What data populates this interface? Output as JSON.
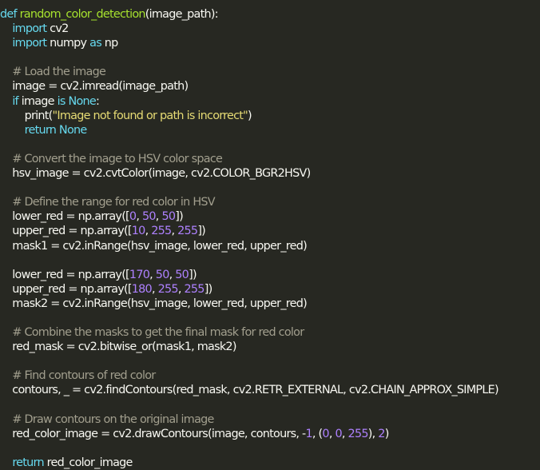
{
  "theme": {
    "background": "#272822",
    "foreground": "#f8f8f2",
    "keyword": "#66d9ef",
    "function": "#a6e22e",
    "comment": "#a29f8e",
    "string": "#e6db74",
    "number": "#ae81ff"
  },
  "code": {
    "lines": [
      [
        {
          "t": "kw",
          "v": "def "
        },
        {
          "t": "fn",
          "v": "random_color_detection"
        },
        {
          "t": "pl",
          "v": "(image_path):"
        }
      ],
      [
        {
          "t": "pl",
          "v": "    "
        },
        {
          "t": "kw",
          "v": "import"
        },
        {
          "t": "pl",
          "v": " cv2"
        }
      ],
      [
        {
          "t": "pl",
          "v": "    "
        },
        {
          "t": "kw",
          "v": "import"
        },
        {
          "t": "pl",
          "v": " numpy "
        },
        {
          "t": "kw",
          "v": "as"
        },
        {
          "t": "pl",
          "v": " np"
        }
      ],
      [],
      [
        {
          "t": "pl",
          "v": "    "
        },
        {
          "t": "cm",
          "v": "# Load the image"
        }
      ],
      [
        {
          "t": "pl",
          "v": "    image = cv2.imread(image_path)"
        }
      ],
      [
        {
          "t": "pl",
          "v": "    "
        },
        {
          "t": "kw",
          "v": "if"
        },
        {
          "t": "pl",
          "v": " image "
        },
        {
          "t": "kw",
          "v": "is None"
        },
        {
          "t": "pl",
          "v": ":"
        }
      ],
      [
        {
          "t": "pl",
          "v": "        print("
        },
        {
          "t": "st",
          "v": "\"Image not found or path is incorrect\""
        },
        {
          "t": "pl",
          "v": ")"
        }
      ],
      [
        {
          "t": "pl",
          "v": "        "
        },
        {
          "t": "kw",
          "v": "return None"
        }
      ],
      [],
      [
        {
          "t": "pl",
          "v": "    "
        },
        {
          "t": "cm",
          "v": "# Convert the image to HSV color space"
        }
      ],
      [
        {
          "t": "pl",
          "v": "    hsv_image = cv2.cvtColor(image, cv2.COLOR_BGR2HSV)"
        }
      ],
      [],
      [
        {
          "t": "pl",
          "v": "    "
        },
        {
          "t": "cm",
          "v": "# Define the range for red color in HSV"
        }
      ],
      [
        {
          "t": "pl",
          "v": "    lower_red = np.array(["
        },
        {
          "t": "nm",
          "v": "0"
        },
        {
          "t": "pl",
          "v": ", "
        },
        {
          "t": "nm",
          "v": "50"
        },
        {
          "t": "pl",
          "v": ", "
        },
        {
          "t": "nm",
          "v": "50"
        },
        {
          "t": "pl",
          "v": "])"
        }
      ],
      [
        {
          "t": "pl",
          "v": "    upper_red = np.array(["
        },
        {
          "t": "nm",
          "v": "10"
        },
        {
          "t": "pl",
          "v": ", "
        },
        {
          "t": "nm",
          "v": "255"
        },
        {
          "t": "pl",
          "v": ", "
        },
        {
          "t": "nm",
          "v": "255"
        },
        {
          "t": "pl",
          "v": "])"
        }
      ],
      [
        {
          "t": "pl",
          "v": "    mask1 = cv2.inRange(hsv_image, lower_red, upper_red)"
        }
      ],
      [],
      [
        {
          "t": "pl",
          "v": "    lower_red = np.array(["
        },
        {
          "t": "nm",
          "v": "170"
        },
        {
          "t": "pl",
          "v": ", "
        },
        {
          "t": "nm",
          "v": "50"
        },
        {
          "t": "pl",
          "v": ", "
        },
        {
          "t": "nm",
          "v": "50"
        },
        {
          "t": "pl",
          "v": "])"
        }
      ],
      [
        {
          "t": "pl",
          "v": "    upper_red = np.array(["
        },
        {
          "t": "nm",
          "v": "180"
        },
        {
          "t": "pl",
          "v": ", "
        },
        {
          "t": "nm",
          "v": "255"
        },
        {
          "t": "pl",
          "v": ", "
        },
        {
          "t": "nm",
          "v": "255"
        },
        {
          "t": "pl",
          "v": "])"
        }
      ],
      [
        {
          "t": "pl",
          "v": "    mask2 = cv2.inRange(hsv_image, lower_red, upper_red)"
        }
      ],
      [],
      [
        {
          "t": "pl",
          "v": "    "
        },
        {
          "t": "cm",
          "v": "# Combine the masks to get the final mask for red color"
        }
      ],
      [
        {
          "t": "pl",
          "v": "    red_mask = cv2.bitwise_or(mask1, mask2)"
        }
      ],
      [],
      [
        {
          "t": "pl",
          "v": "    "
        },
        {
          "t": "cm",
          "v": "# Find contours of red color"
        }
      ],
      [
        {
          "t": "pl",
          "v": "    contours, _ = cv2.findContours(red_mask, cv2.RETR_EXTERNAL, cv2.CHAIN_APPROX_SIMPLE)"
        }
      ],
      [],
      [
        {
          "t": "pl",
          "v": "    "
        },
        {
          "t": "cm",
          "v": "# Draw contours on the original image"
        }
      ],
      [
        {
          "t": "pl",
          "v": "    red_color_image = cv2.drawContours(image, contours, -"
        },
        {
          "t": "nm",
          "v": "1"
        },
        {
          "t": "pl",
          "v": ", ("
        },
        {
          "t": "nm",
          "v": "0"
        },
        {
          "t": "pl",
          "v": ", "
        },
        {
          "t": "nm",
          "v": "0"
        },
        {
          "t": "pl",
          "v": ", "
        },
        {
          "t": "nm",
          "v": "255"
        },
        {
          "t": "pl",
          "v": "), "
        },
        {
          "t": "nm",
          "v": "2"
        },
        {
          "t": "pl",
          "v": ")"
        }
      ],
      [],
      [
        {
          "t": "pl",
          "v": "    "
        },
        {
          "t": "kw",
          "v": "return"
        },
        {
          "t": "pl",
          "v": " red_color_image"
        }
      ]
    ]
  }
}
